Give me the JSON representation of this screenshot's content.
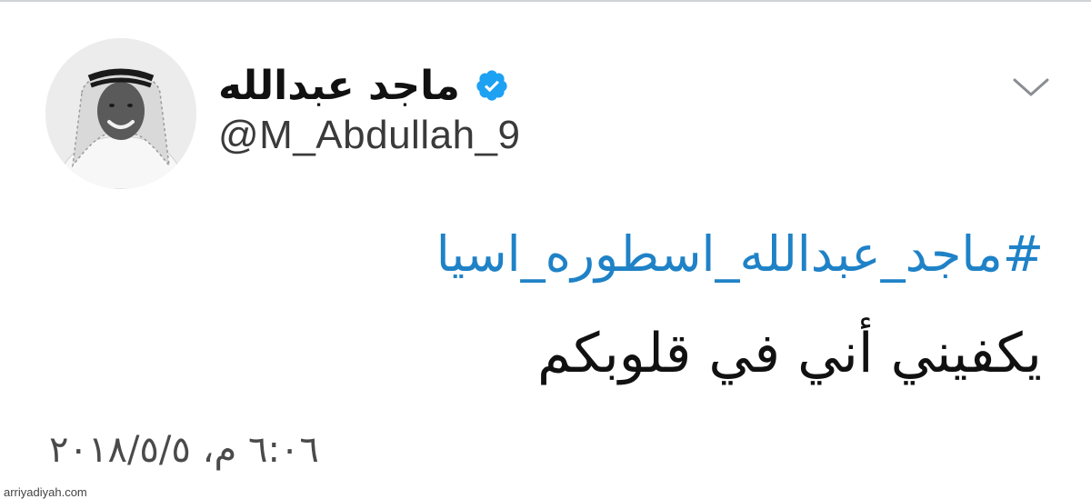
{
  "tweet": {
    "author": {
      "display_name": "ماجد عبدالله",
      "handle": "@M_Abdullah_9",
      "verified": true,
      "avatar_icon": "user-avatar"
    },
    "menu_icon": "chevron-down-icon",
    "hashtag": "#ماجد_عبدالله_اسطوره_اسيا",
    "text": "يكفيني أني في قلوبكم",
    "timestamp": "٦:٠٦ م، ٢٠١٨/٥/٥"
  },
  "watermark": "arriyadiyah.com",
  "colors": {
    "hashtag": "#1f82c7",
    "verified_badge": "#1da1f2",
    "text": "#111111",
    "secondary_text": "#4a4a4a",
    "background": "#ffffff"
  }
}
